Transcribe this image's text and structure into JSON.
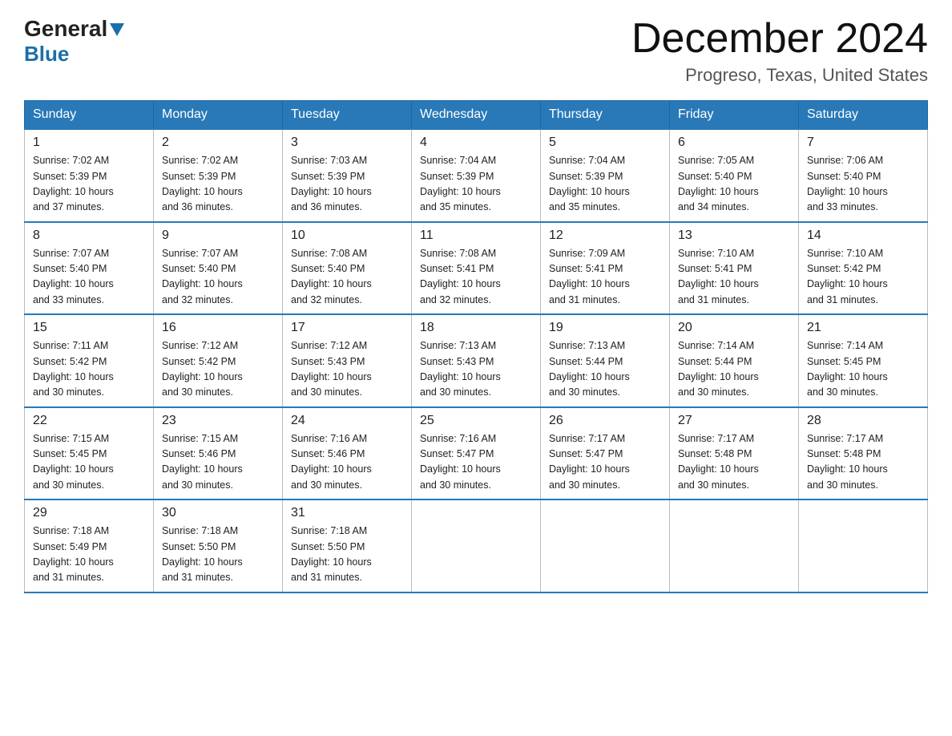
{
  "logo": {
    "general": "General",
    "blue": "Blue"
  },
  "title": {
    "month": "December 2024",
    "location": "Progreso, Texas, United States"
  },
  "headers": [
    "Sunday",
    "Monday",
    "Tuesday",
    "Wednesday",
    "Thursday",
    "Friday",
    "Saturday"
  ],
  "weeks": [
    [
      {
        "day": "1",
        "sunrise": "7:02 AM",
        "sunset": "5:39 PM",
        "daylight": "10 hours and 37 minutes."
      },
      {
        "day": "2",
        "sunrise": "7:02 AM",
        "sunset": "5:39 PM",
        "daylight": "10 hours and 36 minutes."
      },
      {
        "day": "3",
        "sunrise": "7:03 AM",
        "sunset": "5:39 PM",
        "daylight": "10 hours and 36 minutes."
      },
      {
        "day": "4",
        "sunrise": "7:04 AM",
        "sunset": "5:39 PM",
        "daylight": "10 hours and 35 minutes."
      },
      {
        "day": "5",
        "sunrise": "7:04 AM",
        "sunset": "5:39 PM",
        "daylight": "10 hours and 35 minutes."
      },
      {
        "day": "6",
        "sunrise": "7:05 AM",
        "sunset": "5:40 PM",
        "daylight": "10 hours and 34 minutes."
      },
      {
        "day": "7",
        "sunrise": "7:06 AM",
        "sunset": "5:40 PM",
        "daylight": "10 hours and 33 minutes."
      }
    ],
    [
      {
        "day": "8",
        "sunrise": "7:07 AM",
        "sunset": "5:40 PM",
        "daylight": "10 hours and 33 minutes."
      },
      {
        "day": "9",
        "sunrise": "7:07 AM",
        "sunset": "5:40 PM",
        "daylight": "10 hours and 32 minutes."
      },
      {
        "day": "10",
        "sunrise": "7:08 AM",
        "sunset": "5:40 PM",
        "daylight": "10 hours and 32 minutes."
      },
      {
        "day": "11",
        "sunrise": "7:08 AM",
        "sunset": "5:41 PM",
        "daylight": "10 hours and 32 minutes."
      },
      {
        "day": "12",
        "sunrise": "7:09 AM",
        "sunset": "5:41 PM",
        "daylight": "10 hours and 31 minutes."
      },
      {
        "day": "13",
        "sunrise": "7:10 AM",
        "sunset": "5:41 PM",
        "daylight": "10 hours and 31 minutes."
      },
      {
        "day": "14",
        "sunrise": "7:10 AM",
        "sunset": "5:42 PM",
        "daylight": "10 hours and 31 minutes."
      }
    ],
    [
      {
        "day": "15",
        "sunrise": "7:11 AM",
        "sunset": "5:42 PM",
        "daylight": "10 hours and 30 minutes."
      },
      {
        "day": "16",
        "sunrise": "7:12 AM",
        "sunset": "5:42 PM",
        "daylight": "10 hours and 30 minutes."
      },
      {
        "day": "17",
        "sunrise": "7:12 AM",
        "sunset": "5:43 PM",
        "daylight": "10 hours and 30 minutes."
      },
      {
        "day": "18",
        "sunrise": "7:13 AM",
        "sunset": "5:43 PM",
        "daylight": "10 hours and 30 minutes."
      },
      {
        "day": "19",
        "sunrise": "7:13 AM",
        "sunset": "5:44 PM",
        "daylight": "10 hours and 30 minutes."
      },
      {
        "day": "20",
        "sunrise": "7:14 AM",
        "sunset": "5:44 PM",
        "daylight": "10 hours and 30 minutes."
      },
      {
        "day": "21",
        "sunrise": "7:14 AM",
        "sunset": "5:45 PM",
        "daylight": "10 hours and 30 minutes."
      }
    ],
    [
      {
        "day": "22",
        "sunrise": "7:15 AM",
        "sunset": "5:45 PM",
        "daylight": "10 hours and 30 minutes."
      },
      {
        "day": "23",
        "sunrise": "7:15 AM",
        "sunset": "5:46 PM",
        "daylight": "10 hours and 30 minutes."
      },
      {
        "day": "24",
        "sunrise": "7:16 AM",
        "sunset": "5:46 PM",
        "daylight": "10 hours and 30 minutes."
      },
      {
        "day": "25",
        "sunrise": "7:16 AM",
        "sunset": "5:47 PM",
        "daylight": "10 hours and 30 minutes."
      },
      {
        "day": "26",
        "sunrise": "7:17 AM",
        "sunset": "5:47 PM",
        "daylight": "10 hours and 30 minutes."
      },
      {
        "day": "27",
        "sunrise": "7:17 AM",
        "sunset": "5:48 PM",
        "daylight": "10 hours and 30 minutes."
      },
      {
        "day": "28",
        "sunrise": "7:17 AM",
        "sunset": "5:48 PM",
        "daylight": "10 hours and 30 minutes."
      }
    ],
    [
      {
        "day": "29",
        "sunrise": "7:18 AM",
        "sunset": "5:49 PM",
        "daylight": "10 hours and 31 minutes."
      },
      {
        "day": "30",
        "sunrise": "7:18 AM",
        "sunset": "5:50 PM",
        "daylight": "10 hours and 31 minutes."
      },
      {
        "day": "31",
        "sunrise": "7:18 AM",
        "sunset": "5:50 PM",
        "daylight": "10 hours and 31 minutes."
      },
      null,
      null,
      null,
      null
    ]
  ],
  "labels": {
    "sunrise": "Sunrise: ",
    "sunset": "Sunset: ",
    "daylight": "Daylight: "
  }
}
